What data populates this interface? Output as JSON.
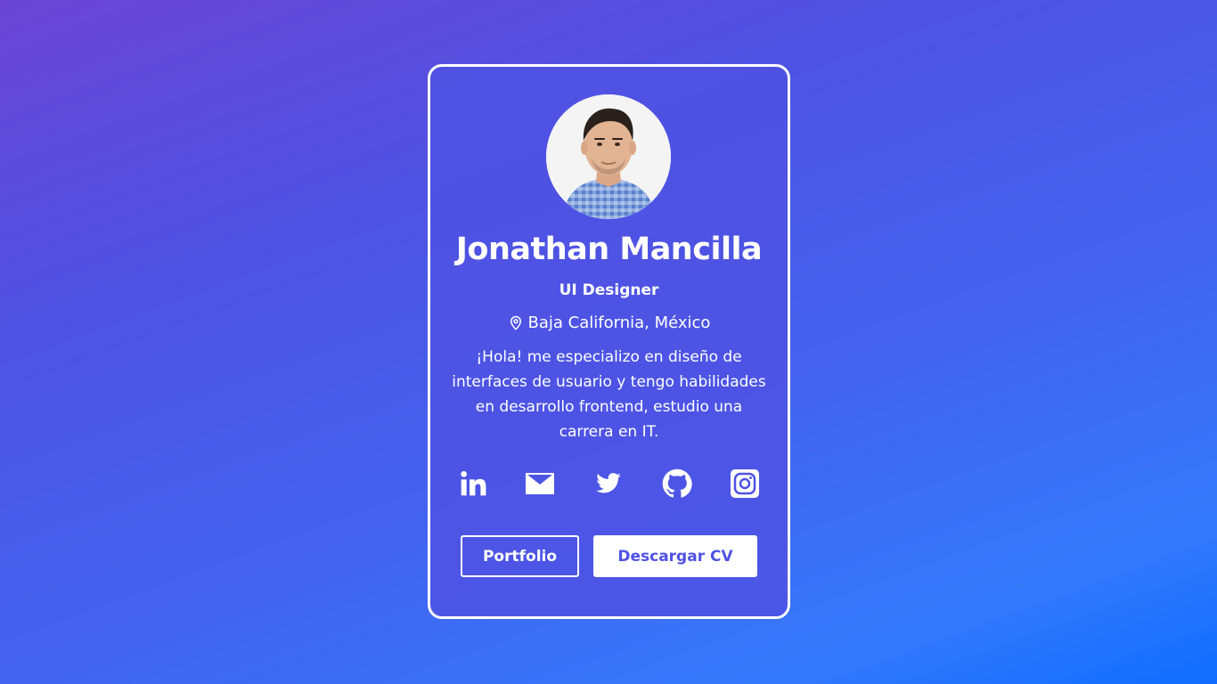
{
  "profile": {
    "name": "Jonathan Mancilla",
    "role": "UI Designer",
    "location": "Baja California, México",
    "bio": "¡Hola! me especializo en diseño de interfaces de usuario y tengo habilidades en desarrollo frontend, estudio una carrera en IT.",
    "avatar_alt": "Jonathan Mancilla"
  },
  "socials": [
    {
      "icon": "linkedin-icon"
    },
    {
      "icon": "mail-icon"
    },
    {
      "icon": "twitter-icon"
    },
    {
      "icon": "github-icon"
    },
    {
      "icon": "instagram-icon"
    }
  ],
  "buttons": {
    "portfolio_label": "Portfolio",
    "cv_label": "Descargar CV"
  },
  "colors": {
    "accent": "#4f52e3",
    "text": "#ffffff",
    "background_start": "#6b46d6",
    "background_end": "#0f6dff"
  }
}
